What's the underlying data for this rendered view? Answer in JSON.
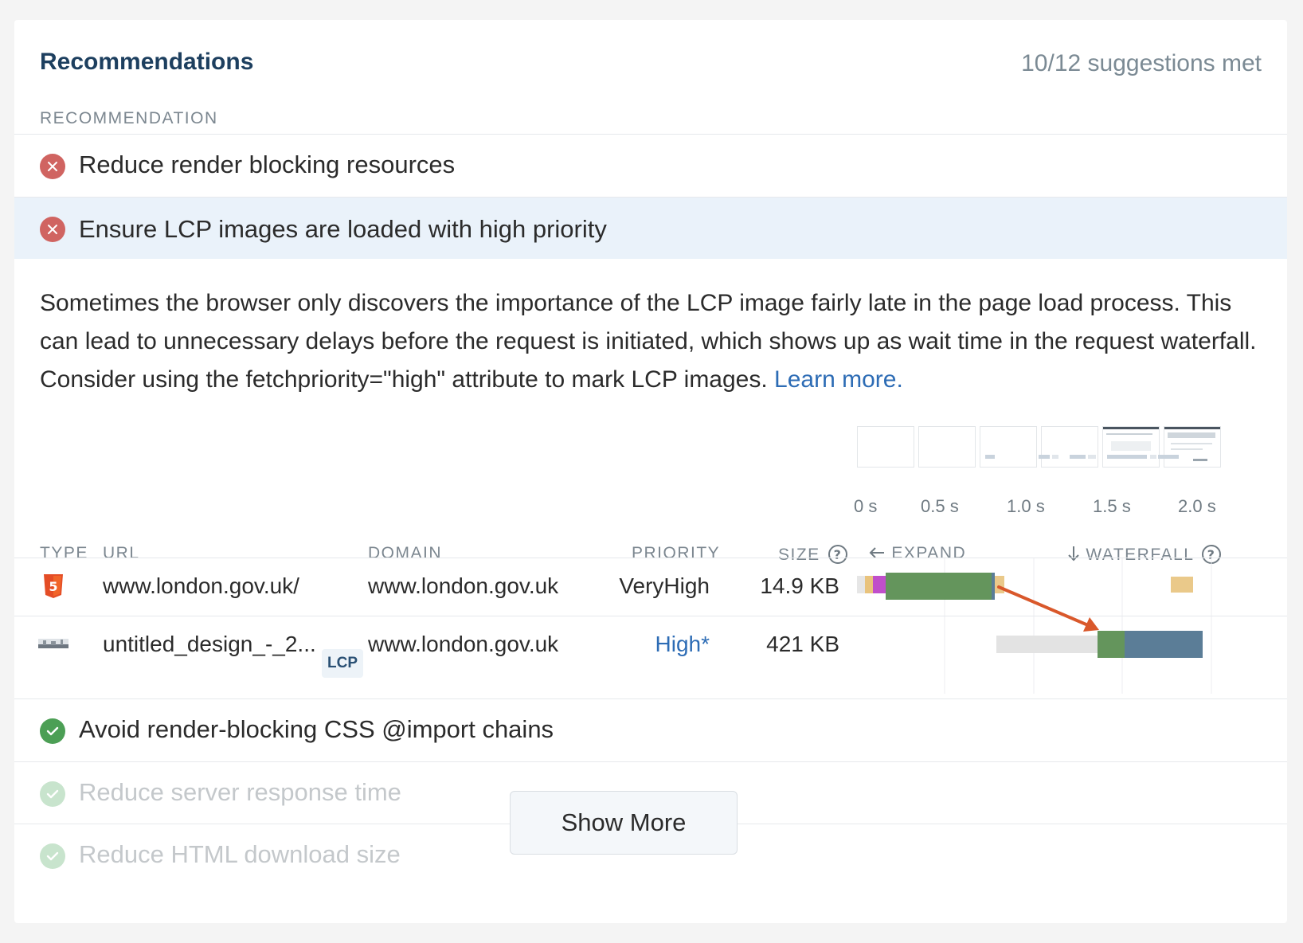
{
  "header": {
    "title": "Recommendations",
    "summary": "10/12 suggestions met",
    "column_heading": "RECOMMENDATION"
  },
  "recommendations": [
    {
      "label": "Reduce render blocking resources",
      "status": "fail"
    },
    {
      "label": "Ensure LCP images are loaded with high priority",
      "status": "fail",
      "selected": true
    },
    {
      "label": "Avoid render-blocking CSS @import chains",
      "status": "pass"
    },
    {
      "label": "Reduce server response time",
      "status": "pass"
    },
    {
      "label": "Reduce HTML download size",
      "status": "pass"
    }
  ],
  "detail": {
    "description": "Sometimes the browser only discovers the importance of the LCP image fairly late in the page load process. This can lead to unnecessary delays before the request is initiated, which shows up as wait time in the request waterfall. Consider using the fetchpriority=\"high\" attribute to mark LCP images.",
    "learn_more": "Learn more."
  },
  "timeline": {
    "ticks": [
      "0 s",
      "0.5 s",
      "1.0 s",
      "1.5 s",
      "2.0 s"
    ]
  },
  "table": {
    "columns": {
      "type": "TYPE",
      "url": "URL",
      "domain": "DOMAIN",
      "priority": "PRIORITY",
      "size": "SIZE",
      "expand": "EXPAND",
      "waterfall": "WATERFALL"
    },
    "rows": [
      {
        "type_icon": "html5-icon",
        "url": "www.london.gov.uk/",
        "domain": "www.london.gov.uk",
        "priority": "VeryHigh",
        "size": "14.9 KB"
      },
      {
        "type_icon": "image-thumbnail-icon",
        "url": "untitled_design_-_2...",
        "badge": "LCP",
        "domain": "www.london.gov.uk",
        "priority": "High*",
        "size": "421 KB"
      }
    ]
  },
  "actions": {
    "show_more": "Show More"
  },
  "colors": {
    "title": "#1d3f5f",
    "fail": "#d06461",
    "pass": "#4c9f55",
    "selected_row": "#eaf2fa",
    "link": "#2d6cb5",
    "waterfall_green": "#64955c",
    "waterfall_blue": "#5b7d97",
    "arrow": "#d9582b"
  }
}
